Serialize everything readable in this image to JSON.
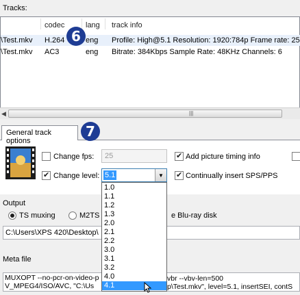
{
  "tracks": {
    "group_label": "Tracks:",
    "columns": [
      "codec",
      "lang",
      "track info"
    ],
    "rows": [
      {
        "file": "\\Test.mkv",
        "codec": "H.264",
        "lang": "eng",
        "info": "Profile: High@5.1  Resolution: 1920:784p  Frame rate: 25"
      },
      {
        "file": "\\Test.mkv",
        "codec": "AC3",
        "lang": "eng",
        "info": "Bitrate: 384Kbps Sample Rate: 48KHz Channels: 6"
      }
    ],
    "callout_6": "6"
  },
  "tabs": {
    "general_label": "General track options",
    "callout_7": "7"
  },
  "options": {
    "change_fps_label": "Change fps:",
    "change_fps_checked": false,
    "fps_value": "25",
    "change_level_label": "Change level:",
    "change_level_checked": true,
    "level_value": "5.1",
    "picture_timing_label": "Add picture timing info",
    "picture_timing_checked": true,
    "sps_pps_label": "Continually insert SPS/PPS",
    "sps_pps_checked": true
  },
  "level_options": [
    "1.0",
    "1.1",
    "1.2",
    "1.3",
    "2.0",
    "2.1",
    "2.2",
    "3.0",
    "3.1",
    "3.2",
    "4.0",
    "4.1"
  ],
  "level_highlight": "4.1",
  "output": {
    "group_label": "Output",
    "ts_muxing_label": "TS muxing",
    "m2ts_label": "M2TS",
    "bluray_label": "e Blu-ray disk",
    "path": "C:\\Users\\XPS 420\\Desktop\\"
  },
  "meta": {
    "label": "Meta file",
    "lines": [
      "MUXOPT --no-pcr-on-video-p",
      "V_MPEG4/ISO/AVC, \"C:\\Us",
      "vbr  --vbv-len=500",
      "p\\Test.mkv\", level=5.1, insertSEI, contS"
    ]
  },
  "colors": {
    "accent": "#3399ff",
    "callout": "#1e3c94"
  }
}
